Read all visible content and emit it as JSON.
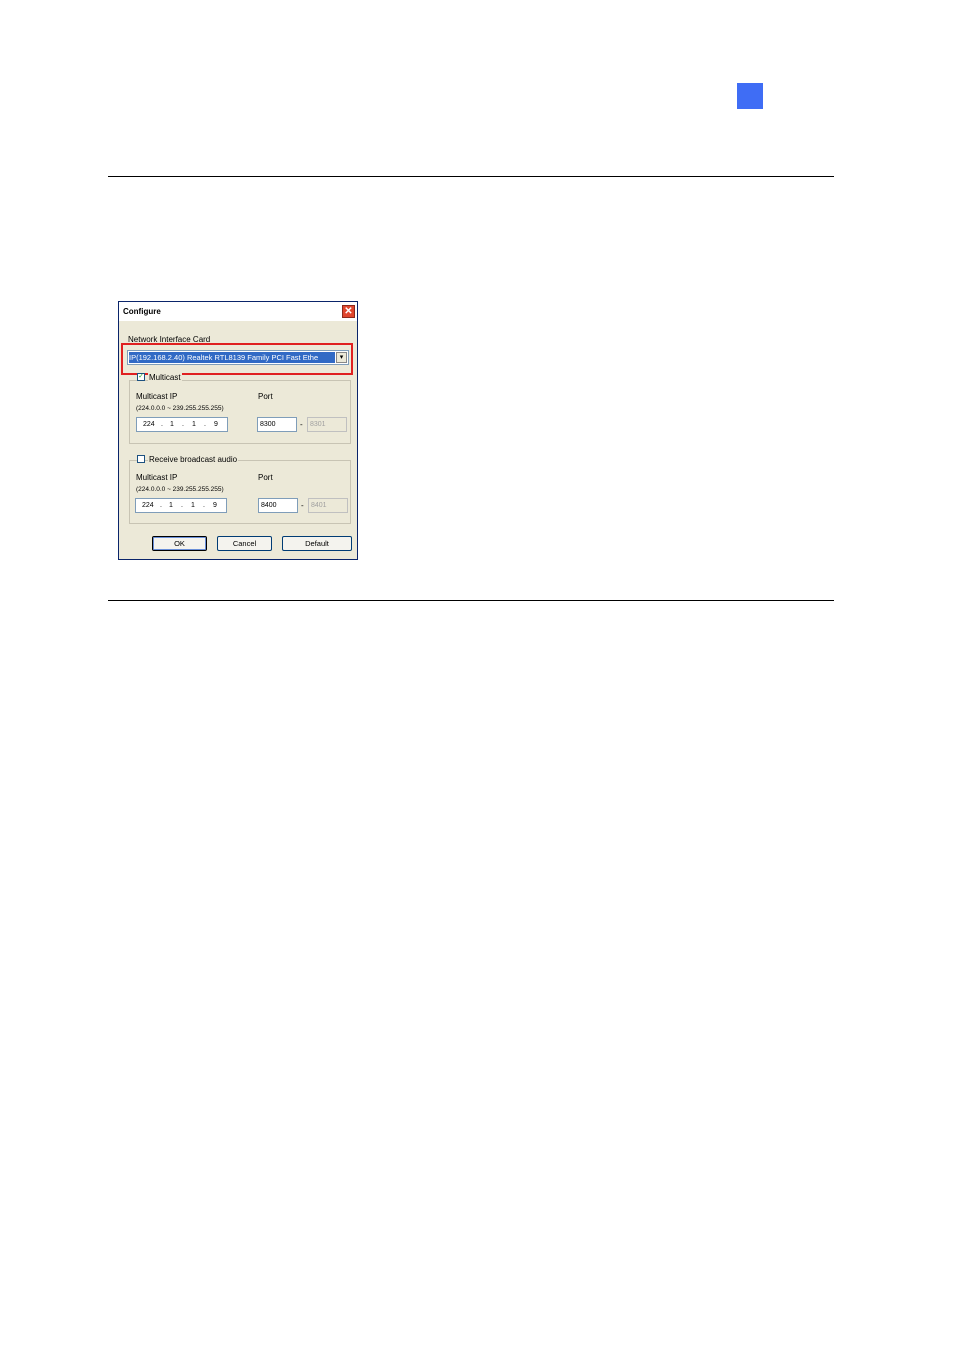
{
  "dialog": {
    "title": "Configure",
    "close_glyph": "✕",
    "nic_label": "Network Interface Card",
    "nic_selected": "IP(192.168.2.40) Realtek RTL8139 Family PCI Fast Ethe",
    "dropdown_glyph": "▾",
    "video": {
      "checkbox_label": "Multicast",
      "checked": true,
      "check_glyph": "✓",
      "ip_label": "Multicast IP",
      "ip_range": "(224.0.0.0 ~ 239.255.255.255)",
      "port_label": "Port",
      "ip_octets": [
        "224",
        "1",
        "1",
        "9"
      ],
      "port_start": "8300",
      "port_dash": "-",
      "port_end": "8301"
    },
    "audio": {
      "checkbox_label": "Receive broadcast audio",
      "checked": false,
      "ip_label": "Multicast IP",
      "ip_range": "(224.0.0.0 ~ 239.255.255.255)",
      "port_label": "Port",
      "ip_octets": [
        "224",
        "1",
        "1",
        "9"
      ],
      "port_start": "8400",
      "port_dash": "-",
      "port_end": "8401"
    },
    "buttons": {
      "ok": "OK",
      "cancel": "Cancel",
      "default": "Default"
    }
  },
  "colors": {
    "page_marker": "#3f6df5",
    "highlight": "#e02020",
    "selection": "#316ac5"
  }
}
